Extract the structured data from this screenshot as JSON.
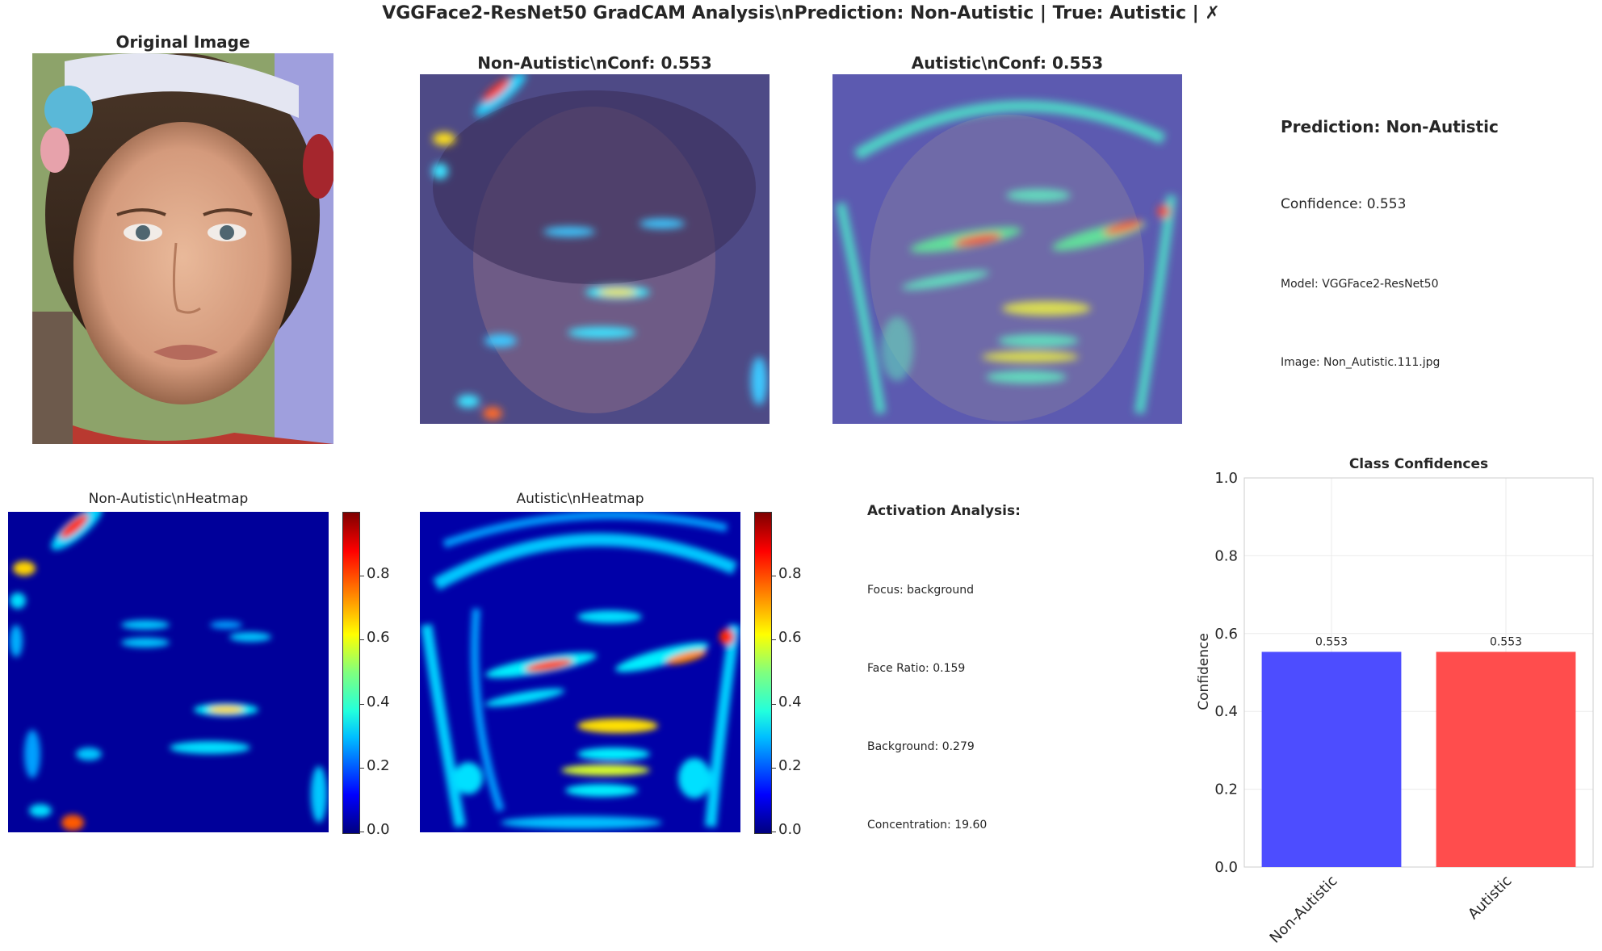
{
  "suptitle": "VGGFace2-ResNet50 GradCAM Analysis\\nPrediction: Non-Autistic | True: Autistic | ✗",
  "panels": {
    "original_title": "Original Image",
    "overlay_nonautistic_title": "Non-Autistic\\nConf: 0.553",
    "overlay_autistic_title": "Autistic\\nConf: 0.553",
    "heatmap_nonautistic_title": "Non-Autistic\\nHeatmap",
    "heatmap_autistic_title": "Autistic\\nHeatmap"
  },
  "prediction_info": {
    "prediction": "Prediction: Non-Autistic",
    "confidence": "Confidence: 0.553",
    "model": "Model: VGGFace2-ResNet50",
    "image": "Image: Non_Autistic.111.jpg"
  },
  "activation_analysis": {
    "title": "Activation Analysis:",
    "focus": "Focus: background",
    "face_ratio": "Face Ratio: 0.159",
    "background": "Background: 0.279",
    "concentration": "Concentration: 19.60"
  },
  "colorbar": {
    "ticks": [
      "0.0",
      "0.2",
      "0.4",
      "0.6",
      "0.8"
    ],
    "tick_values": [
      0.0,
      0.2,
      0.4,
      0.6,
      0.8
    ],
    "max": 1.0,
    "colormap": [
      "#00007f",
      "#0000ff",
      "#00bfff",
      "#22ffdd",
      "#7fff7f",
      "#ffff00",
      "#ff8000",
      "#ff0000",
      "#7f0000"
    ]
  },
  "chart_data": {
    "type": "bar",
    "title": "Class Confidences",
    "xlabel": "",
    "ylabel": "Confidence",
    "categories": [
      "Non-Autistic",
      "Autistic"
    ],
    "values": [
      0.553,
      0.553
    ],
    "value_labels": [
      "0.553",
      "0.553"
    ],
    "colors": [
      "#4d4dff",
      "#ff4d4d"
    ],
    "ylim": [
      0,
      1.0
    ],
    "yticks": [
      0.0,
      0.2,
      0.4,
      0.6,
      0.8,
      1.0
    ],
    "ytick_labels": [
      "0.0",
      "0.2",
      "0.4",
      "0.6",
      "0.8",
      "1.0"
    ],
    "grid": true
  }
}
